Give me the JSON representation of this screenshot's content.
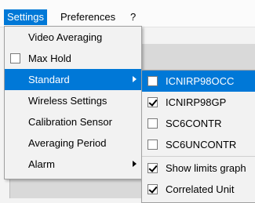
{
  "menubar": {
    "settings": "Settings",
    "preferences": "Preferences",
    "help": "?"
  },
  "settings_menu": {
    "items": [
      {
        "label": "Video Averaging"
      },
      {
        "label": "Max Hold",
        "checked": false
      },
      {
        "label": "Standard",
        "highlighted": true,
        "has_submenu": true
      },
      {
        "label": "Wireless Settings"
      },
      {
        "label": "Calibration Sensor"
      },
      {
        "label": "Averaging Period"
      },
      {
        "label": "Alarm",
        "has_submenu": true
      }
    ]
  },
  "standard_submenu": {
    "items": [
      {
        "label": "ICNIRP98OCC",
        "checked": false,
        "highlighted": true
      },
      {
        "label": "ICNIRP98GP",
        "checked": true
      },
      {
        "label": "SC6CONTR",
        "checked": false
      },
      {
        "label": "SC6UNCONTR",
        "checked": false
      },
      {
        "label": "Show limits graph",
        "checked": true
      },
      {
        "label": "Correlated Unit",
        "checked": true
      }
    ]
  },
  "colors": {
    "highlight": "#0078d7",
    "menu_background": "#f2f2f2",
    "panel": "#d9d9d9"
  }
}
